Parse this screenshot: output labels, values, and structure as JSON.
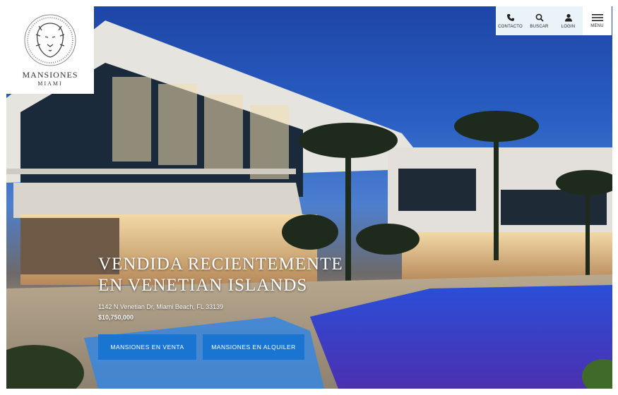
{
  "brand": {
    "name_line1": "Mansiones",
    "name_line2": "Miami",
    "logo_icon": "lion-crest-icon"
  },
  "nav": {
    "items": [
      {
        "label": "Contacto",
        "icon": "phone-icon"
      },
      {
        "label": "Buscar",
        "icon": "search-icon"
      },
      {
        "label": "Login",
        "icon": "user-icon"
      },
      {
        "label": "Menu",
        "icon": "hamburger-icon"
      }
    ]
  },
  "hero": {
    "headline_line1": "Vendida Recientemente",
    "headline_line2": "en Venetian Islands",
    "address": "1142 N Venetian Dr, Miami Beach, FL 33139",
    "price": "$10,750,000",
    "button_sale": "Mansiones en Venta",
    "button_rent": "Mansiones en Alquiler"
  },
  "colors": {
    "accent": "#1a74d1",
    "nav_bg": "#e9f3f8",
    "sky": "#1d46a6"
  }
}
